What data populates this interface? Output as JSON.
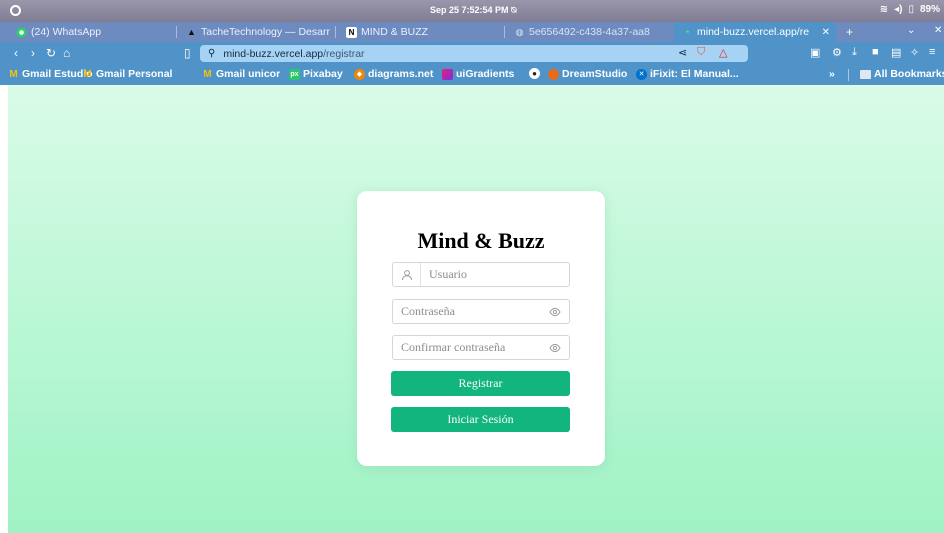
{
  "os": {
    "clock": "Sep 25  7:52:54 PM",
    "battery": "89%"
  },
  "tabs": [
    {
      "label": "(24) WhatsApp",
      "icon": "whatsapp-icon"
    },
    {
      "label": "TacheTechnology — Desarr",
      "icon": "tache-icon"
    },
    {
      "label": "MIND & BUZZ",
      "icon": "notion-icon"
    },
    {
      "label": "5e656492-c438-4a37-aa8",
      "icon": "globe-icon"
    },
    {
      "label": "mind-buzz.vercel.app/re",
      "icon": "vercel-icon"
    }
  ],
  "address": {
    "host": "mind-buzz.vercel.app",
    "path": "/registrar"
  },
  "bookmarks": [
    {
      "label": "Gmail Estudio",
      "icon": "gmail-icon"
    },
    {
      "label": "Gmail Personal",
      "icon": "gmail-icon"
    },
    {
      "label": "Gmail unicor",
      "icon": "gmail-icon"
    },
    {
      "label": "Pixabay",
      "icon": "pixabay-icon"
    },
    {
      "label": "diagrams.net",
      "icon": "diagrams-icon"
    },
    {
      "label": "uiGradients",
      "icon": "uigradients-icon"
    },
    {
      "label": "",
      "icon": "github-icon"
    },
    {
      "label": "DreamStudio",
      "icon": "dreamstudio-icon"
    },
    {
      "label": "iFixit: El Manual...",
      "icon": "ifixit-icon"
    }
  ],
  "bookmarks_more": "»",
  "all_bookmarks": "All Bookmarks",
  "form": {
    "title": "Mind & Buzz",
    "username_placeholder": "Usuario",
    "password_placeholder": "Contraseña",
    "confirm_placeholder": "Confirmar contraseña",
    "register_label": "Registrar",
    "login_label": "Iniciar Sesión"
  },
  "colors": {
    "accent": "#12b57d",
    "browser_chrome": "#4f93c9",
    "page_gradient_top": "#d9fbe8",
    "page_gradient_bottom": "#9ff2c4"
  }
}
